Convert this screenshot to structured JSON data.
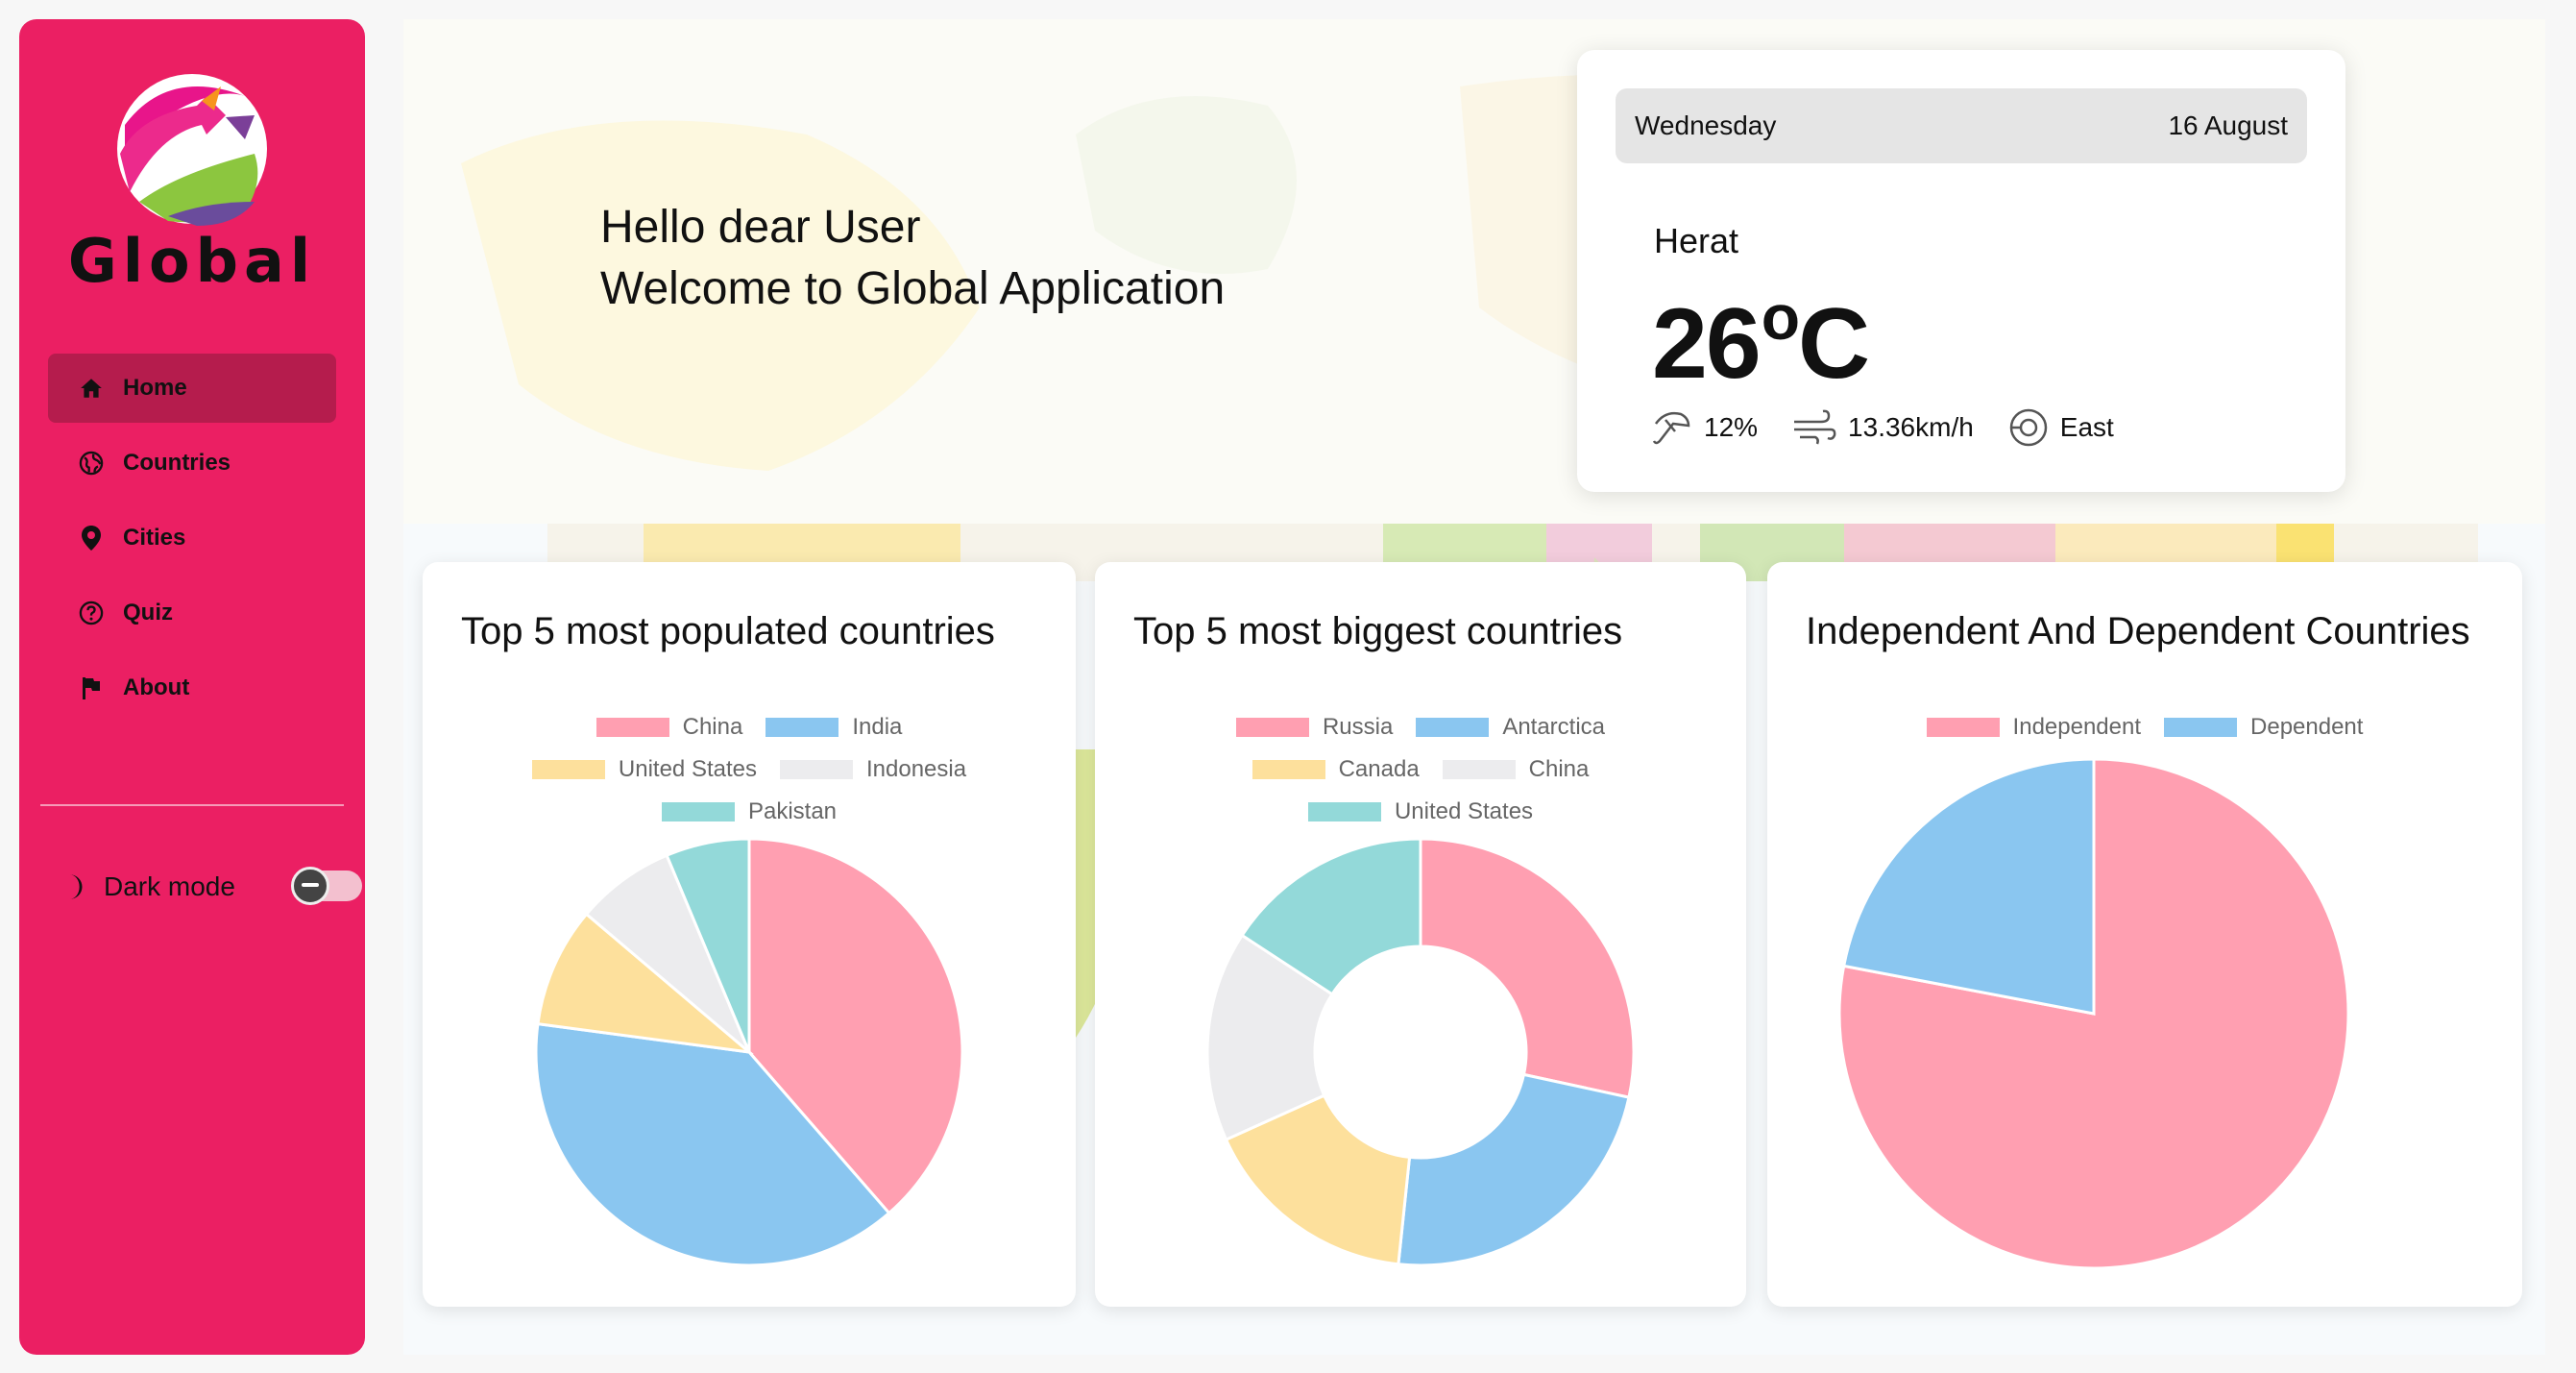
{
  "app": {
    "name": "Global"
  },
  "sidebar": {
    "items": [
      {
        "label": "Home",
        "icon": "home-icon",
        "active": true
      },
      {
        "label": "Countries",
        "icon": "globe-icon",
        "active": false
      },
      {
        "label": "Cities",
        "icon": "location-pin-icon",
        "active": false
      },
      {
        "label": "Quiz",
        "icon": "question-circle-icon",
        "active": false
      },
      {
        "label": "About",
        "icon": "flag-icon",
        "active": false
      }
    ],
    "dark_mode_label": "Dark mode",
    "dark_mode_on": false
  },
  "greeting": {
    "line1": "Hello dear User",
    "line2": "Welcome to Global Application"
  },
  "weather": {
    "day": "Wednesday",
    "date": "16 August",
    "city": "Herat",
    "temp": "26",
    "unit_sup": "o",
    "unit": "C",
    "humidity": "12%",
    "wind_speed": "13.36km/h",
    "wind_direction": "East"
  },
  "colors": {
    "sidebar": "#eb1f63",
    "pink": "#ff9fb1",
    "blue": "#8ac6f0",
    "yellow": "#fde09c",
    "grey": "#ececee",
    "teal": "#93d9d9"
  },
  "chart_data": [
    {
      "type": "pie",
      "title": "Top 5 most populated countries",
      "categories": [
        "China",
        "India",
        "United States",
        "Indonesia",
        "Pakistan"
      ],
      "values": [
        1412,
        1408,
        332,
        274,
        231
      ],
      "colors": [
        "#ff9fb1",
        "#8ac6f0",
        "#fde09c",
        "#ececee",
        "#93d9d9"
      ],
      "legend": "top"
    },
    {
      "type": "doughnut",
      "title": "Top 5 most biggest countries",
      "categories": [
        "Russia",
        "Antarctica",
        "Canada",
        "China",
        "United States"
      ],
      "values": [
        17.1,
        14.0,
        10.0,
        9.6,
        9.5
      ],
      "colors": [
        "#ff9fb1",
        "#8ac6f0",
        "#fde09c",
        "#ececee",
        "#93d9d9"
      ],
      "legend": "top"
    },
    {
      "type": "pie",
      "title": "Independent And Dependent Countries",
      "categories": [
        "Independent",
        "Dependent"
      ],
      "values": [
        195,
        55
      ],
      "colors": [
        "#ff9fb1",
        "#8ac6f0"
      ],
      "legend": "top"
    }
  ]
}
